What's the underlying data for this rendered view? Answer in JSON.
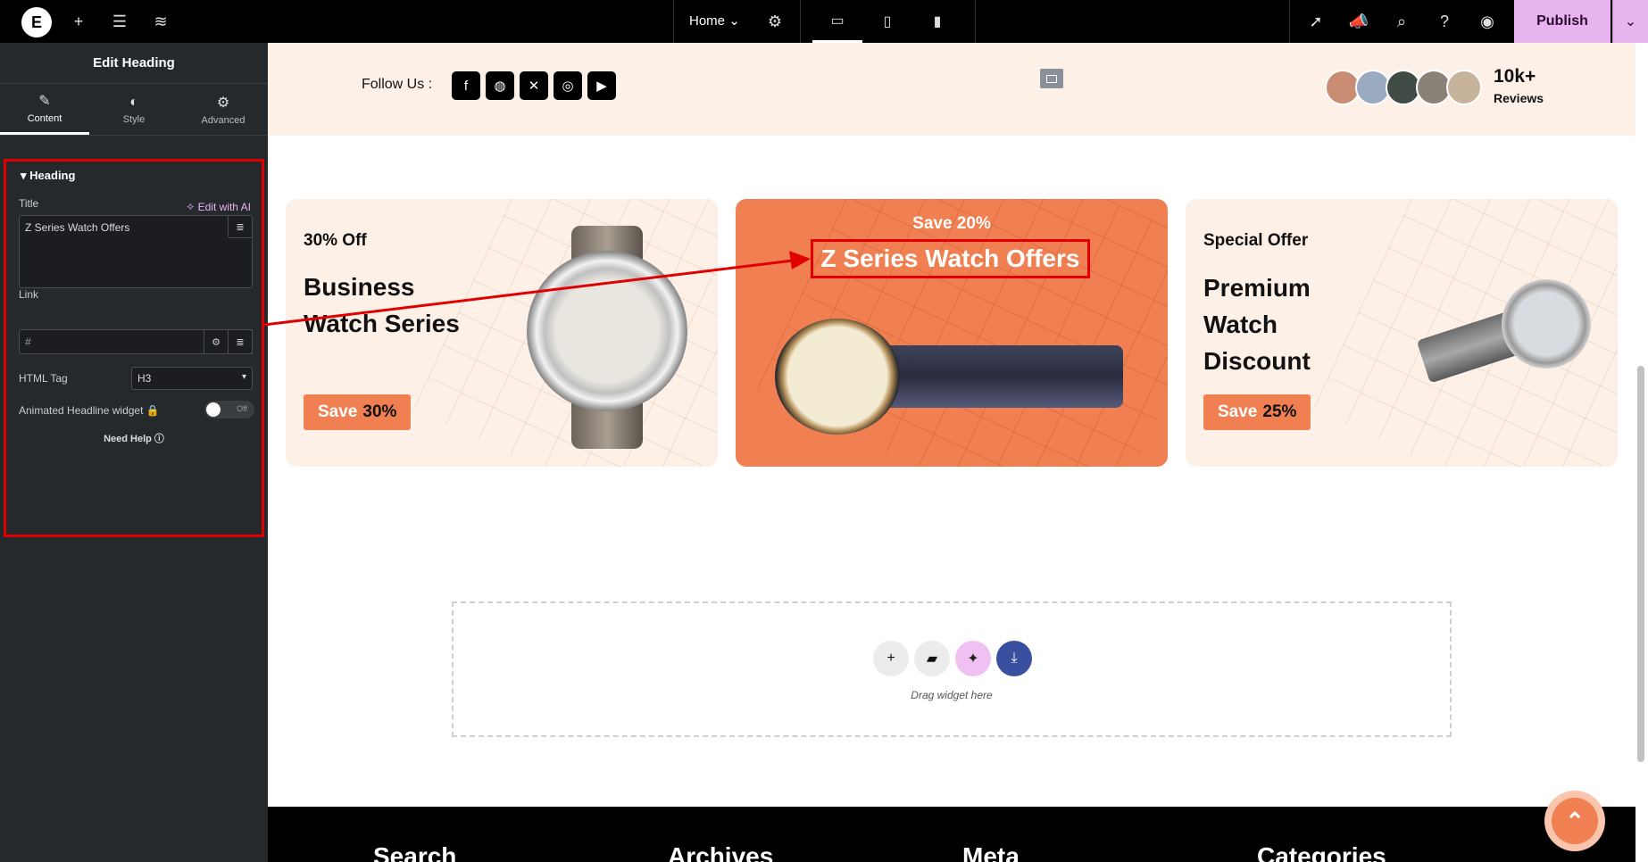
{
  "topbar": {
    "page_name": "Home",
    "publish_label": "Publish"
  },
  "panel": {
    "title": "Edit Heading",
    "tabs": [
      {
        "label": "Content"
      },
      {
        "label": "Style"
      },
      {
        "label": "Advanced"
      }
    ],
    "section_title": "Heading",
    "title_label": "Title",
    "edit_ai_label": "Edit with AI",
    "title_value": "Z Series Watch Offers",
    "link_label": "Link",
    "link_placeholder": "#",
    "html_tag_label": "HTML Tag",
    "html_tag_value": "H3",
    "animated_label": "Animated Headline widget",
    "toggle_state": "Off",
    "help_label": "Need Help"
  },
  "canvas": {
    "follow_label": "Follow Us :",
    "reviews_count": "10k+",
    "reviews_label": "Reviews",
    "cards": [
      {
        "subtitle": "30% Off",
        "title": "Business Watch Series",
        "save_prefix": "Save",
        "save_value": "30%"
      },
      {
        "subtitle": "Save 20%",
        "title": "Z Series Watch Offers"
      },
      {
        "subtitle": "Special Offer",
        "title": "Premium Watch Discount",
        "save_prefix": "Save",
        "save_value": "25%"
      }
    ],
    "drop_zone_text": "Drag widget here",
    "footer_headings": [
      "Search",
      "Archives",
      "Meta",
      "Categories"
    ]
  },
  "colors": {
    "accent_orange": "#f07f52",
    "publish_bg": "#e8b4f0",
    "panel_bg": "#26292c",
    "highlight_red": "#e00000"
  }
}
